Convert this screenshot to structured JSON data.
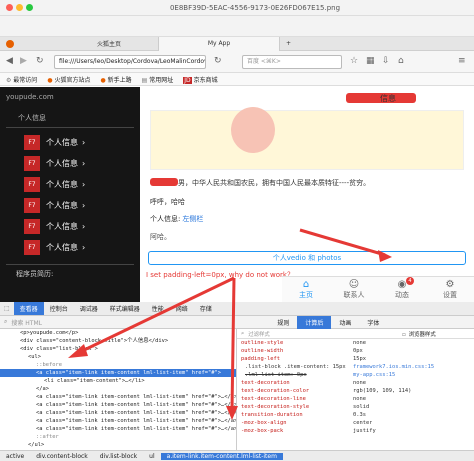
{
  "window": {
    "title": "0E8BF39D-5EAC-4556-9173-0E26FD067E15.png",
    "colors": {
      "close": "#fd5f57",
      "min": "#febb2e",
      "max": "#27c840"
    }
  },
  "tabs": [
    {
      "label": "火狐主页"
    },
    {
      "label": "My App"
    }
  ],
  "nav": {
    "url": "file:///Users/leo/Desktop/Cordova/LeoMalinCordova/",
    "search_placeholder": "百度 <⌘K>"
  },
  "bookmarks": [
    {
      "label": "最常访问"
    },
    {
      "label": "火狐官方站点"
    },
    {
      "label": "新手上路"
    },
    {
      "label": "常用网址"
    },
    {
      "label": "京东商城"
    }
  ],
  "sidebar": {
    "site": "youpude.com",
    "section": "个人信息",
    "items": [
      {
        "badge": "F7",
        "label": "个人信息"
      },
      {
        "badge": "F7",
        "label": "个人信息"
      },
      {
        "badge": "F7",
        "label": "个人信息"
      },
      {
        "badge": "F7",
        "label": "个人信息"
      },
      {
        "badge": "F7",
        "label": "个人信息"
      },
      {
        "badge": "F7",
        "label": "个人信息"
      }
    ],
    "footer": "程序员简历:"
  },
  "main": {
    "header": "信息",
    "bio": "男，中华人民共和国农民，拥有中国人民最本质特征----贫穷。",
    "greeting": "呼呼，哈哈",
    "info_label": "个人信息:",
    "info_link": "左侧栏",
    "extra": "阿哈。",
    "button": "个人vedio 和 photos",
    "annotation": "I set padding-left=0px, why do not work？"
  },
  "bottom_tabs": [
    {
      "label": "主页",
      "icon": "home-icon"
    },
    {
      "label": "联系人",
      "icon": "contacts-icon"
    },
    {
      "label": "动态",
      "icon": "feed-icon",
      "badge": "4"
    },
    {
      "label": "设置",
      "icon": "settings-icon"
    }
  ],
  "devtools": {
    "tabs": [
      "查看器",
      "控制台",
      "调试器",
      "样式编辑器",
      "性能",
      "网络",
      "存储"
    ],
    "search_placeholder": "搜索 HTML",
    "style_tabs": [
      "规则",
      "计算后",
      "动画",
      "字体"
    ],
    "filter_placeholder": "过滤样式",
    "browser_styles": "浏览器样式",
    "html": [
      "<p>youpude.com</p>",
      "<div class=\"content-block-title\">个人信息</div>",
      "<div class=\"list-block\">",
      "<ul>",
      "::before",
      "<a class=\"item-link item-content lml-list-item\" href=\"#\">",
      "<li class=\"item-content\">…</li>",
      "</a>",
      "<a class=\"item-link item-content lml-list-item\" href=\"#\">…</a>",
      "<a class=\"item-link item-content lml-list-item\" href=\"#\">…</a>",
      "<a class=\"item-link item-content lml-list-item\" href=\"#\">…</a>",
      "<a class=\"item-link item-content lml-list-item\" href=\"#\">…</a>",
      "<a class=\"item-link item-content lml-list-item\" href=\"#\">…</a>",
      "::after",
      "</ul>"
    ],
    "styles": [
      {
        "prop": "outline-style",
        "val": "none"
      },
      {
        "prop": "outline-width",
        "val": "0px"
      },
      {
        "prop": "padding-left",
        "val": "15px"
      },
      {
        "prop": ".list-block .item-content: 15px",
        "val": "framework7.ios.min.css:15"
      },
      {
        "prop": ".lml-list-item: 0px",
        "val": "my-app.css:15"
      },
      {
        "prop": "text-decoration",
        "val": "none"
      },
      {
        "prop": "text-decoration-color",
        "val": "rgb(109, 109, 114)"
      },
      {
        "prop": "text-decoration-line",
        "val": "none"
      },
      {
        "prop": "text-decoration-style",
        "val": "solid"
      },
      {
        "prop": "transition-duration",
        "val": "0.3s"
      },
      {
        "prop": "-moz-box-align",
        "val": "center"
      },
      {
        "prop": "-moz-box-pack",
        "val": "justify"
      }
    ],
    "breadcrumbs": [
      "active",
      "div.content-block",
      "div.list-block",
      "ul",
      "a.item-link.item-content.lml-list-item"
    ]
  }
}
